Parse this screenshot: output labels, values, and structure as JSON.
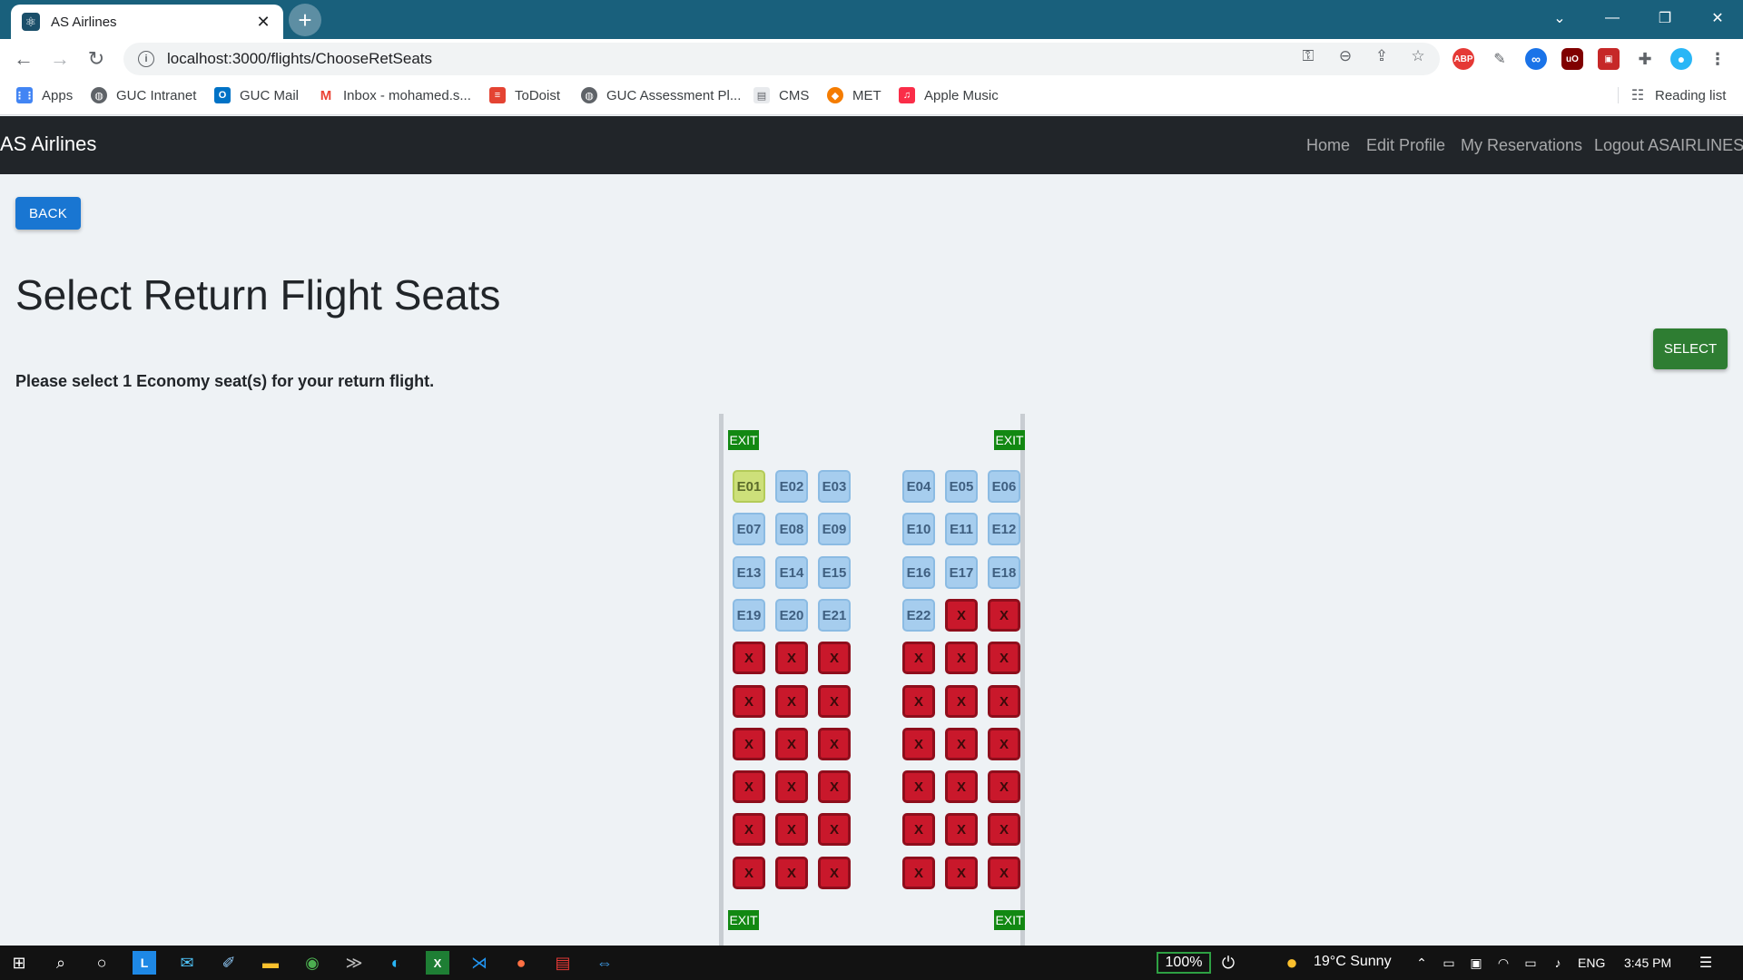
{
  "browser": {
    "tab_title": "AS Airlines",
    "url": "localhost:3000/flights/ChooseRetSeats",
    "bookmarks": [
      "Apps",
      "GUC Intranet",
      "GUC Mail",
      "Inbox - mohamed.s...",
      "ToDoist",
      "GUC Assessment Pl...",
      "CMS",
      "MET",
      "Apple Music"
    ],
    "reading_list": "Reading list",
    "extensions": [
      "ABP",
      "uO"
    ]
  },
  "navbar": {
    "brand": "AS Airlines",
    "links": [
      "Home",
      "Edit Profile",
      "My Reservations",
      "Logout ASAIRLINES"
    ]
  },
  "page": {
    "back_label": "BACK",
    "title": "Select Return Flight Seats",
    "select_label": "SELECT",
    "instruction": "Please select 1 Economy seat(s) for your return flight.",
    "exit_label": "EXIT"
  },
  "seat_map": {
    "occupied_label": "X",
    "rows": [
      [
        {
          "label": "E01",
          "status": "selected"
        },
        {
          "label": "E02",
          "status": "available"
        },
        {
          "label": "E03",
          "status": "available"
        },
        {
          "label": "E04",
          "status": "available"
        },
        {
          "label": "E05",
          "status": "available"
        },
        {
          "label": "E06",
          "status": "available"
        }
      ],
      [
        {
          "label": "E07",
          "status": "available"
        },
        {
          "label": "E08",
          "status": "available"
        },
        {
          "label": "E09",
          "status": "available"
        },
        {
          "label": "E10",
          "status": "available"
        },
        {
          "label": "E11",
          "status": "available"
        },
        {
          "label": "E12",
          "status": "available"
        }
      ],
      [
        {
          "label": "E13",
          "status": "available"
        },
        {
          "label": "E14",
          "status": "available"
        },
        {
          "label": "E15",
          "status": "available"
        },
        {
          "label": "E16",
          "status": "available"
        },
        {
          "label": "E17",
          "status": "available"
        },
        {
          "label": "E18",
          "status": "available"
        }
      ],
      [
        {
          "label": "E19",
          "status": "available"
        },
        {
          "label": "E20",
          "status": "available"
        },
        {
          "label": "E21",
          "status": "available"
        },
        {
          "label": "E22",
          "status": "available"
        },
        {
          "label": "X",
          "status": "occupied"
        },
        {
          "label": "X",
          "status": "occupied"
        }
      ],
      [
        {
          "label": "X",
          "status": "occupied"
        },
        {
          "label": "X",
          "status": "occupied"
        },
        {
          "label": "X",
          "status": "occupied"
        },
        {
          "label": "X",
          "status": "occupied"
        },
        {
          "label": "X",
          "status": "occupied"
        },
        {
          "label": "X",
          "status": "occupied"
        }
      ],
      [
        {
          "label": "X",
          "status": "occupied"
        },
        {
          "label": "X",
          "status": "occupied"
        },
        {
          "label": "X",
          "status": "occupied"
        },
        {
          "label": "X",
          "status": "occupied"
        },
        {
          "label": "X",
          "status": "occupied"
        },
        {
          "label": "X",
          "status": "occupied"
        }
      ],
      [
        {
          "label": "X",
          "status": "occupied"
        },
        {
          "label": "X",
          "status": "occupied"
        },
        {
          "label": "X",
          "status": "occupied"
        },
        {
          "label": "X",
          "status": "occupied"
        },
        {
          "label": "X",
          "status": "occupied"
        },
        {
          "label": "X",
          "status": "occupied"
        }
      ],
      [
        {
          "label": "X",
          "status": "occupied"
        },
        {
          "label": "X",
          "status": "occupied"
        },
        {
          "label": "X",
          "status": "occupied"
        },
        {
          "label": "X",
          "status": "occupied"
        },
        {
          "label": "X",
          "status": "occupied"
        },
        {
          "label": "X",
          "status": "occupied"
        }
      ],
      [
        {
          "label": "X",
          "status": "occupied"
        },
        {
          "label": "X",
          "status": "occupied"
        },
        {
          "label": "X",
          "status": "occupied"
        },
        {
          "label": "X",
          "status": "occupied"
        },
        {
          "label": "X",
          "status": "occupied"
        },
        {
          "label": "X",
          "status": "occupied"
        }
      ],
      [
        {
          "label": "X",
          "status": "occupied"
        },
        {
          "label": "X",
          "status": "occupied"
        },
        {
          "label": "X",
          "status": "occupied"
        },
        {
          "label": "X",
          "status": "occupied"
        },
        {
          "label": "X",
          "status": "occupied"
        },
        {
          "label": "X",
          "status": "occupied"
        }
      ]
    ]
  },
  "taskbar": {
    "battery": "100%",
    "weather": "19°C  Sunny",
    "language": "ENG",
    "time": "3:45 PM"
  },
  "colors": {
    "tabstrip": "#19607c",
    "navbar": "#212529",
    "back_button": "#1976d2",
    "select_button": "#2e7d32",
    "seat_available": "#a6cdee",
    "seat_selected": "#cde07a",
    "seat_occupied": "#c9182b",
    "exit_sign": "#128812"
  }
}
